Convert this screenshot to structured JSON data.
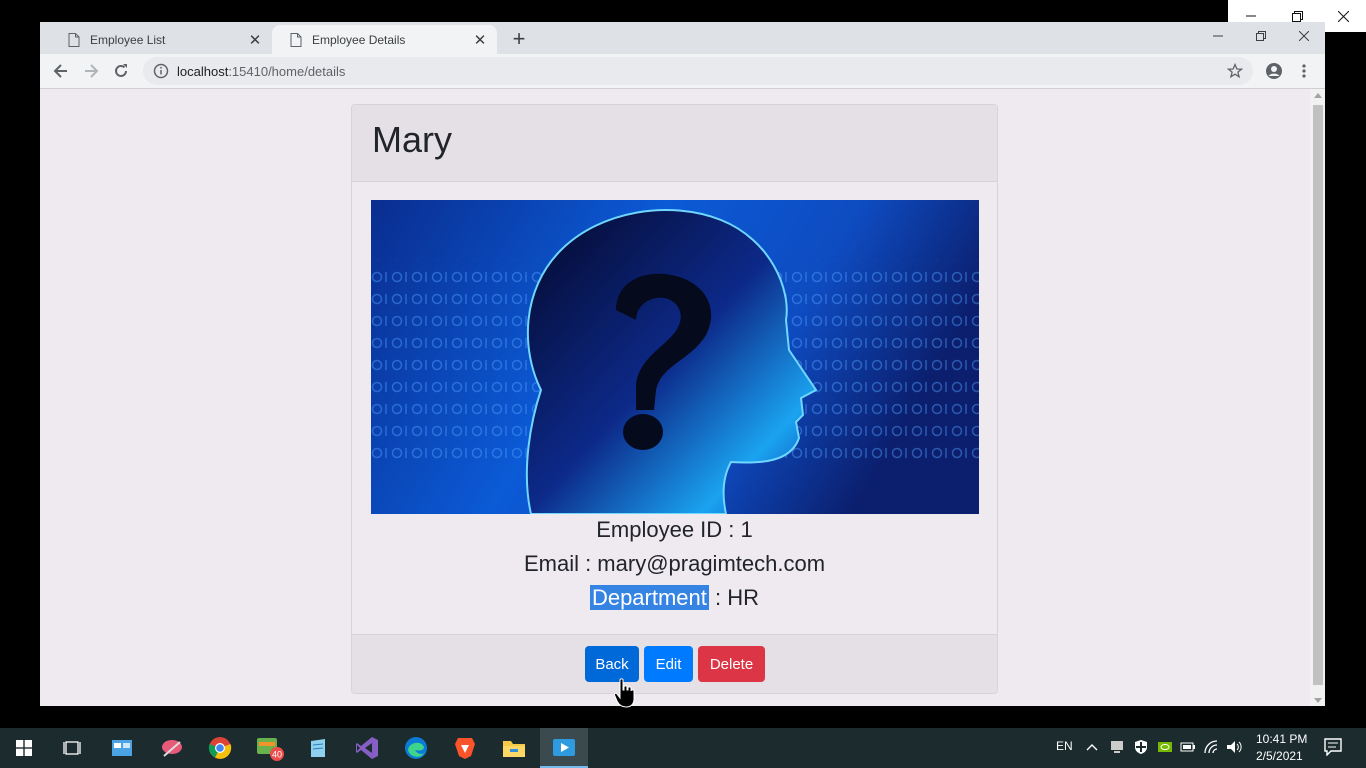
{
  "browser": {
    "tabs": [
      {
        "title": "Employee List",
        "active": false
      },
      {
        "title": "Employee Details",
        "active": true
      }
    ],
    "url_host": "localhost",
    "url_path": ":15410/home/details"
  },
  "employee": {
    "name": "Mary",
    "id_line": "Employee ID : 1",
    "email_line": "Email : mary@pragimtech.com",
    "department_label": "Department",
    "department_rest": " : HR"
  },
  "buttons": {
    "back": "Back",
    "edit": "Edit",
    "delete": "Delete"
  },
  "taskbar": {
    "lang": "EN",
    "time": "10:41 PM",
    "date": "2/5/2021",
    "badge_count": "40"
  },
  "colors": {
    "primary": "#007bff",
    "danger": "#dc3545",
    "page_bg": "#efe9f0"
  }
}
